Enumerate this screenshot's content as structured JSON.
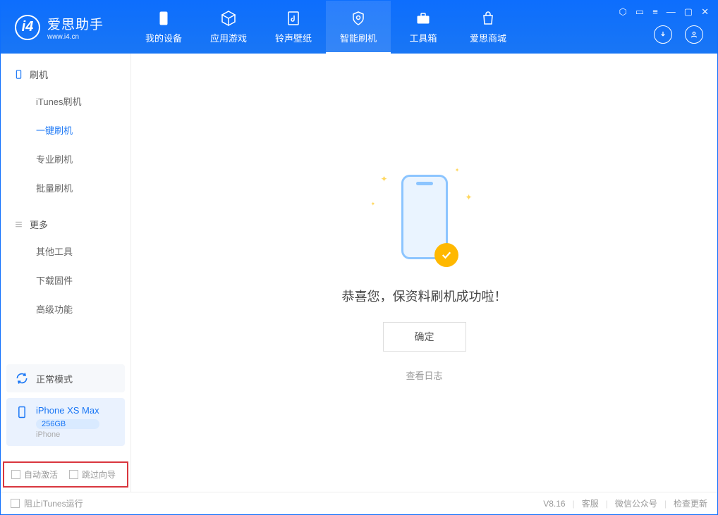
{
  "app": {
    "title": "爱思助手",
    "url": "www.i4.cn"
  },
  "nav": {
    "tabs": [
      {
        "label": "我的设备"
      },
      {
        "label": "应用游戏"
      },
      {
        "label": "铃声壁纸"
      },
      {
        "label": "智能刷机"
      },
      {
        "label": "工具箱"
      },
      {
        "label": "爱思商城"
      }
    ]
  },
  "sidebar": {
    "section1": {
      "title": "刷机",
      "items": [
        "iTunes刷机",
        "一键刷机",
        "专业刷机",
        "批量刷机"
      ]
    },
    "section2": {
      "title": "更多",
      "items": [
        "其他工具",
        "下载固件",
        "高级功能"
      ]
    },
    "device_mode": "正常模式",
    "device": {
      "name": "iPhone XS Max",
      "storage": "256GB",
      "type": "iPhone"
    },
    "checkbox1": "自动激活",
    "checkbox2": "跳过向导"
  },
  "main": {
    "message": "恭喜您，保资料刷机成功啦！",
    "confirm": "确定",
    "log_link": "查看日志"
  },
  "status": {
    "stop_itunes": "阻止iTunes运行",
    "version": "V8.16",
    "links": [
      "客服",
      "微信公众号",
      "检查更新"
    ]
  }
}
